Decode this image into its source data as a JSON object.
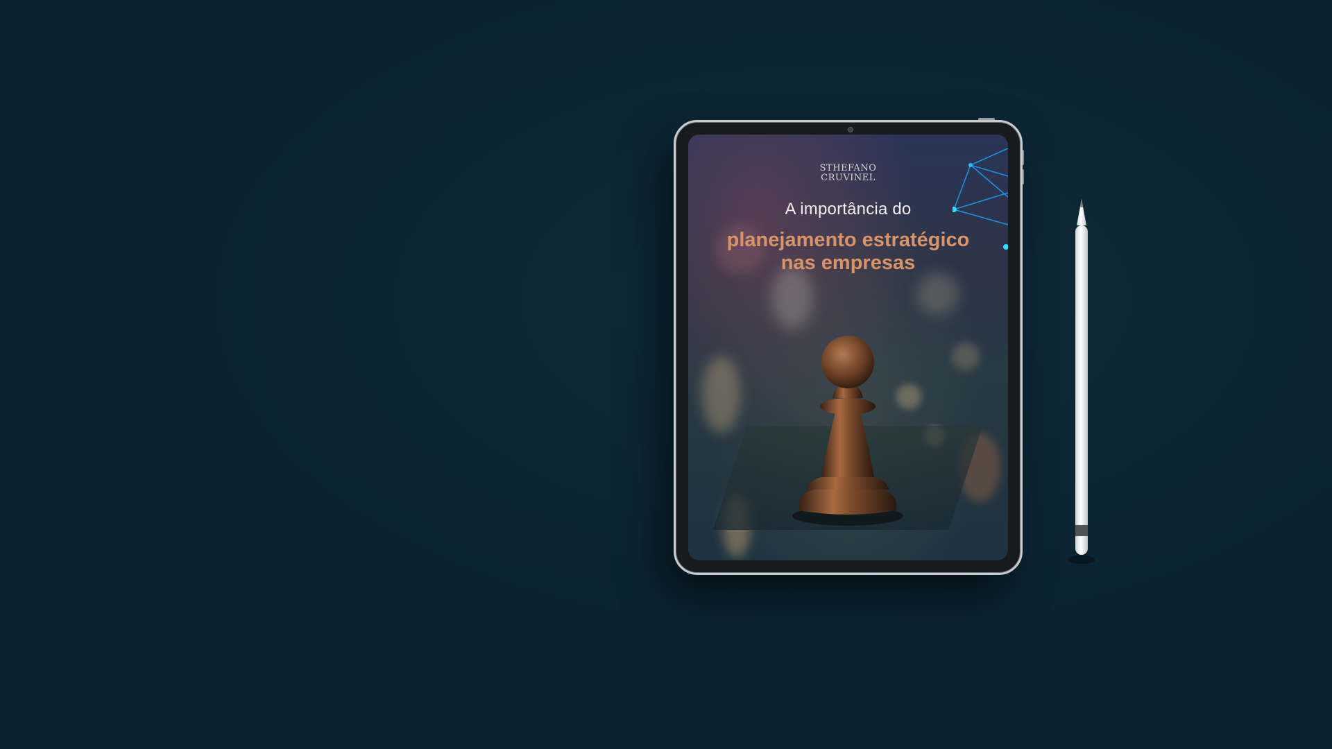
{
  "cover": {
    "brand_line_1": "STHEFANO",
    "brand_line_2": "CRUVINEL",
    "title_line_1": "A importância do",
    "title_line_2": "planejamento estratégico",
    "title_line_3": "nas empresas"
  },
  "colors": {
    "background": "#0b2331",
    "title_accent": "#d7936a",
    "title_light": "#f1eee9",
    "network_lines": "#1e8fe0"
  },
  "icons": {
    "pawn": "chess-pawn-icon",
    "network": "network-nodes-icon"
  }
}
